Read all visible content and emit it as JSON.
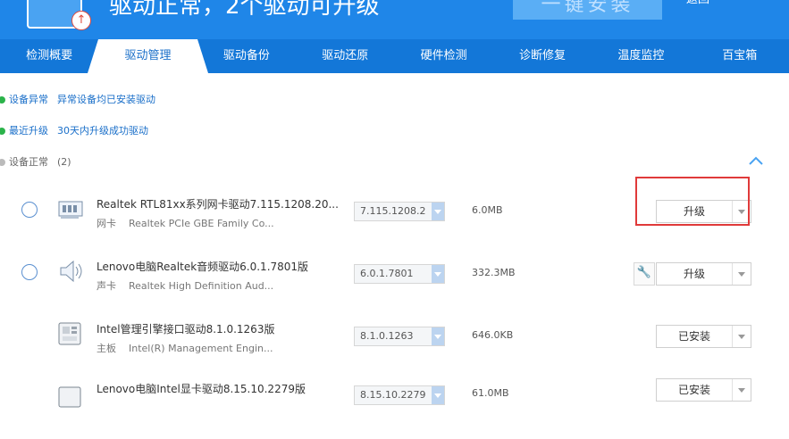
{
  "header": {
    "status_text": "驱动正常，2个驱动可升级",
    "install_button": "一键安装",
    "back_link": "返回"
  },
  "tabs": [
    "检测概要",
    "驱动管理",
    "驱动备份",
    "驱动还原",
    "硬件检测",
    "诊断修复",
    "温度监控",
    "百宝箱"
  ],
  "summary": {
    "abnormal": {
      "label": "设备异常",
      "text": "异常设备均已安装驱动"
    },
    "recent": {
      "label": "最近升级",
      "text": "30天内升级成功驱动"
    },
    "normal": {
      "label": "设备正常",
      "count": "(2)"
    }
  },
  "drivers": [
    {
      "name": "Realtek RTL81xx系列网卡驱动7.115.1208.20...",
      "kind": "网卡",
      "device": "Realtek PCIe GBE Family Co...",
      "version": "7.115.1208.2",
      "size": "6.0MB",
      "action": "升级",
      "icon": "network-card-icon"
    },
    {
      "name": "Lenovo电脑Realtek音频驱动6.0.1.7801版",
      "kind": "声卡",
      "device": "Realtek High Definition Aud...",
      "version": "6.0.1.7801",
      "size": "332.3MB",
      "action": "升级",
      "icon": "speaker-icon"
    },
    {
      "name": "Intel管理引擎接口驱动8.1.0.1263版",
      "kind": "主板",
      "device": "Intel(R) Management Engin...",
      "version": "8.1.0.1263",
      "size": "646.0KB",
      "action": "已安装",
      "icon": "motherboard-icon"
    },
    {
      "name": "Lenovo电脑Intel显卡驱动8.15.10.2279版",
      "kind": "",
      "device": "",
      "version": "8.15.10.2279",
      "size": "61.0MB",
      "action": "已安装",
      "icon": "graphics-card-icon"
    }
  ]
}
